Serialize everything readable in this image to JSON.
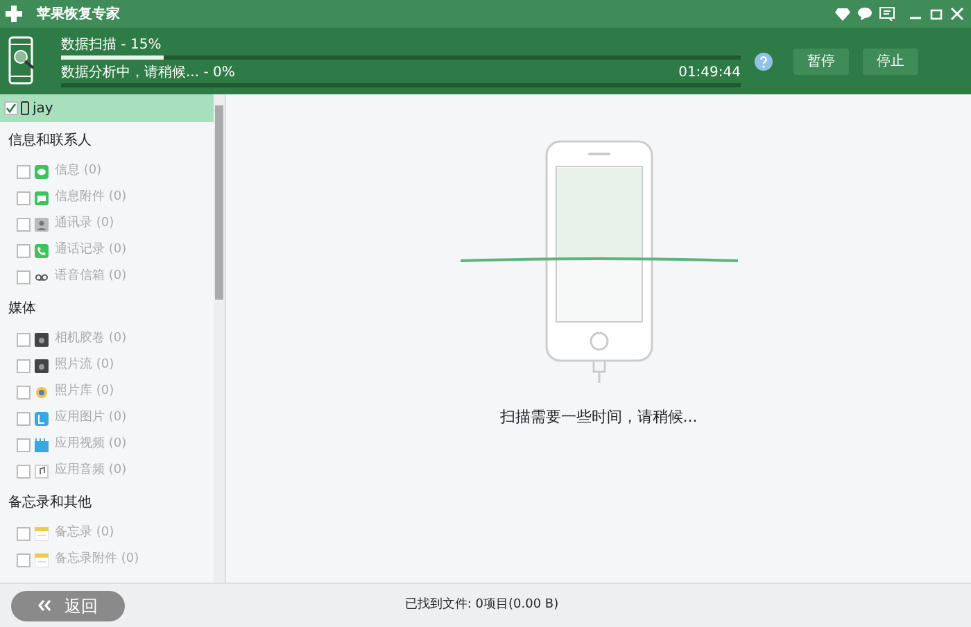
{
  "window": {
    "title": "苹果恢复专家"
  },
  "progress": [
    {
      "label": "数据扫描 - 15%",
      "level": 0.15
    },
    {
      "label": "数据分析中，请稍候... - 0%",
      "level": 0,
      "time": "01:49:44"
    }
  ],
  "buttons": [
    {
      "label": "暂停"
    },
    {
      "label": "停止"
    }
  ],
  "device": {
    "name": "jay",
    "checked": true,
    "selected": true
  },
  "groups": [
    {
      "title": "信息和联系人",
      "items": [
        {
          "label": "信息 (0)",
          "checked": false
        },
        {
          "label": "信息附件 (0)",
          "checked": false
        },
        {
          "label": "通讯录 (0)",
          "checked": false
        },
        {
          "label": "通话记录 (0)",
          "checked": false
        },
        {
          "label": "语音信箱 (0)",
          "checked": false
        }
      ]
    },
    {
      "title": "媒体",
      "items": [
        {
          "label": "相机胶卷 (0)",
          "checked": false
        },
        {
          "label": "照片流 (0)",
          "checked": false
        },
        {
          "label": "照片库 (0)",
          "checked": false
        },
        {
          "label": "应用图片 (0)",
          "checked": false
        },
        {
          "label": "应用视频 (0)",
          "checked": false
        },
        {
          "label": "应用音频 (0)",
          "checked": false
        }
      ]
    },
    {
      "title": "备忘录和其他",
      "items": [
        {
          "label": "备忘录 (0)",
          "checked": false
        },
        {
          "label": "备忘录附件 (0)",
          "checked": false
        }
      ]
    }
  ],
  "scan_message": "扫描需要一些时间，请稍候...",
  "back_button": "返回",
  "status": "已找到文件: 0项目(0.00 B)"
}
